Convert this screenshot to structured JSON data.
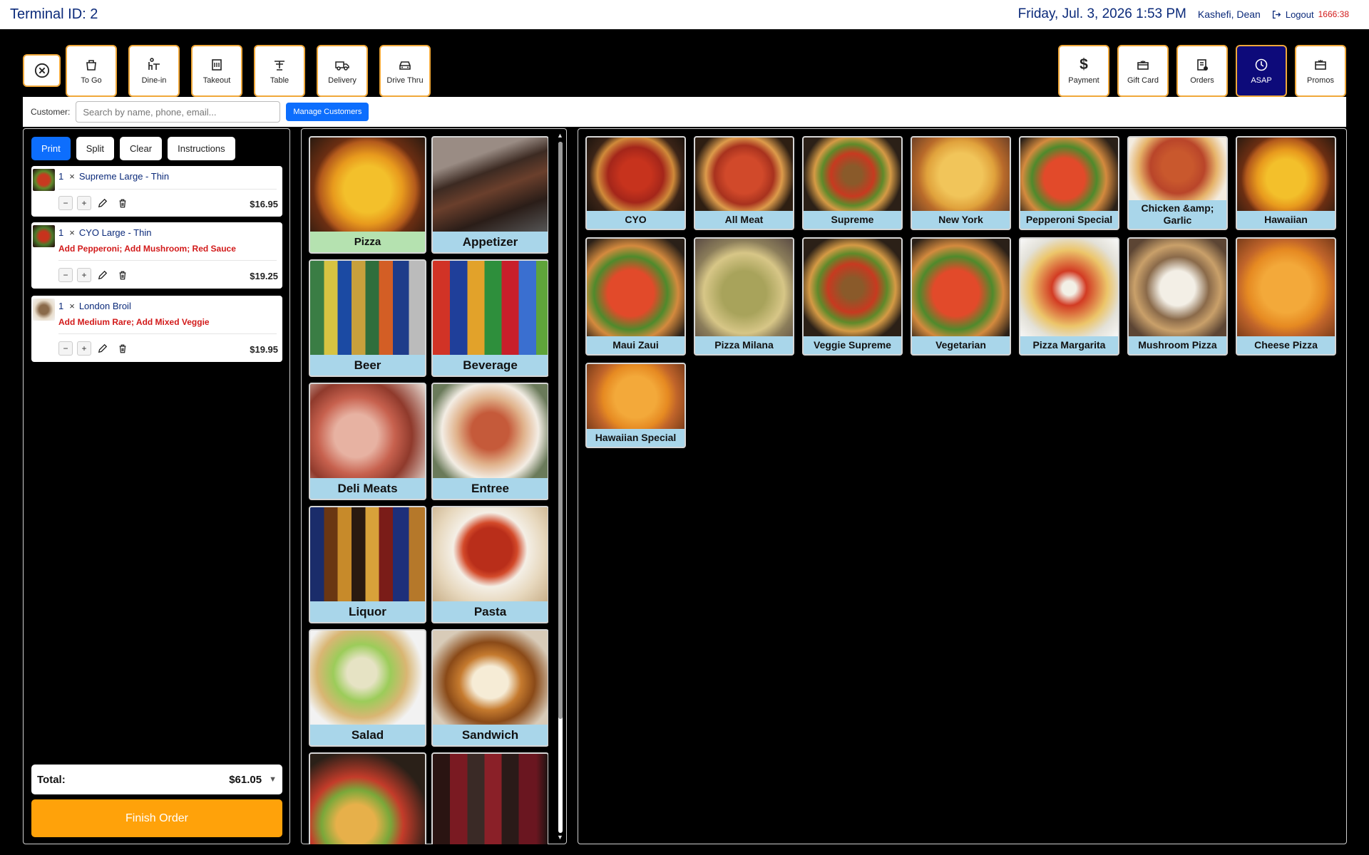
{
  "header": {
    "terminal": "Terminal ID: 2",
    "datetime": "Friday, Jul. 3, 2026 1:53 PM",
    "user": "Kashefi, Dean",
    "logout_label": "Logout",
    "timer": "1666:38"
  },
  "toolbar": {
    "left": [
      {
        "label": "To Go",
        "icon": "to-go-icon"
      },
      {
        "label": "Dine-in",
        "icon": "dine-in-icon"
      },
      {
        "label": "Takeout",
        "icon": "takeout-icon"
      },
      {
        "label": "Table",
        "icon": "table-icon"
      },
      {
        "label": "Delivery",
        "icon": "delivery-icon"
      },
      {
        "label": "Drive Thru",
        "icon": "car-icon"
      }
    ],
    "right": [
      {
        "label": "Payment",
        "icon": "dollar-icon"
      },
      {
        "label": "Gift Card",
        "icon": "gift-card-icon"
      },
      {
        "label": "Orders",
        "icon": "orders-icon"
      },
      {
        "label": "ASAP",
        "icon": "clock-icon",
        "active": true
      },
      {
        "label": "Promos",
        "icon": "promos-icon"
      }
    ]
  },
  "customer": {
    "label": "Customer:",
    "placeholder": "Search by name, phone, email...",
    "manage_label": "Manage Customers"
  },
  "order": {
    "actions": [
      "Print",
      "Split",
      "Clear",
      "Instructions"
    ],
    "items": [
      {
        "qty": "1",
        "name": "Supreme Large - Thin",
        "mods": "",
        "price": "$16.95"
      },
      {
        "qty": "1",
        "name": "CYO Large - Thin",
        "mods": "Add Pepperoni; Add Mushroom; Red Sauce",
        "price": "$19.25"
      },
      {
        "qty": "1",
        "name": "London Broil",
        "mods": "Add Medium Rare; Add Mixed Veggie",
        "price": "$19.95"
      }
    ],
    "total_label": "Total:",
    "total_value": "$61.05",
    "finish_label": "Finish Order"
  },
  "categories": [
    {
      "name": "Pizza",
      "selected": true
    },
    {
      "name": "Appetizer"
    },
    {
      "name": "Beer"
    },
    {
      "name": "Beverage"
    },
    {
      "name": "Deli Meats"
    },
    {
      "name": "Entree"
    },
    {
      "name": "Liquor"
    },
    {
      "name": "Pasta"
    },
    {
      "name": "Salad"
    },
    {
      "name": "Sandwich"
    },
    {
      "name": ""
    },
    {
      "name": ""
    }
  ],
  "products": [
    "CYO",
    "All Meat",
    "Supreme",
    "New York",
    "Pepperoni Special",
    "Chicken &amp; Garlic",
    "Hawaiian",
    "Maui Zaui",
    "Pizza Milana",
    "Veggie Supreme",
    "Vegetarian",
    "Pizza Margarita",
    "Mushroom Pizza",
    "Cheese Pizza",
    "Hawaiian Special"
  ],
  "colors": {
    "accent_orange": "#ffa20a",
    "primary_blue": "#0d6efd",
    "active_navy": "#0d0a7a",
    "caption_blue": "#a9d6ea",
    "caption_selected": "#b5e2b0",
    "modifier_red": "#d21a1a"
  }
}
